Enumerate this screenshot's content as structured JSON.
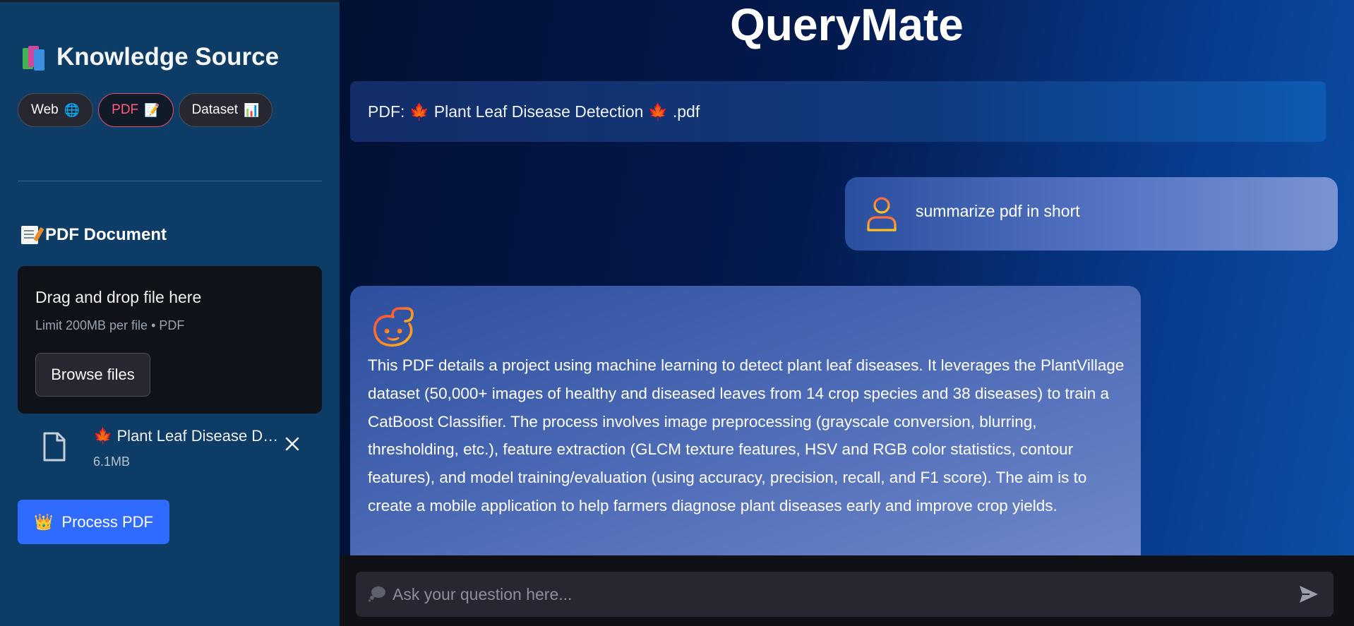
{
  "sidebar": {
    "title": "Knowledge Source",
    "source_tabs": [
      {
        "label": "Web",
        "emoji": "🌐"
      },
      {
        "label": "PDF",
        "emoji": "📝"
      },
      {
        "label": "Dataset",
        "emoji": "📊"
      }
    ],
    "active_tab": "PDF",
    "section_title": "PDF Document",
    "dropzone": {
      "title": "Drag and drop file here",
      "limit": "Limit 200MB per file • PDF",
      "browse_label": "Browse files"
    },
    "uploaded_file": {
      "name": "🍁 Plant Leaf Disease Detection 🍁 .pdf",
      "size": "6.1MB"
    },
    "process_label": "Process PDF",
    "process_emoji": "👑"
  },
  "main": {
    "app_title": "QueryMate",
    "pdf_label": "PDF: 🍁 Plant Leaf Disease Detection 🍁 .pdf",
    "messages": [
      {
        "role": "user",
        "icon": "user-icon",
        "text": "summarize pdf in short"
      },
      {
        "role": "assistant",
        "icon": "bot-icon",
        "text": "This PDF details a project using machine learning to detect plant leaf diseases. It leverages the PlantVillage dataset (50,000+ images of healthy and diseased leaves from 14 crop species and 38 diseases) to train a CatBoost Classifier. The process involves image preprocessing (grayscale conversion, blurring, thresholding, etc.), feature extraction (GLCM texture features, HSV and RGB color statistics, contour features), and model training/evaluation (using accuracy, precision, recall, and F1 score). The aim is to create a mobile application to help farmers diagnose plant diseases early and improve crop yields."
      }
    ]
  },
  "chat_input": {
    "placeholder": "Ask your question here...",
    "value": ""
  },
  "colors": {
    "sidebar_bg": "#0d3c66",
    "accent_button": "#2f6bff",
    "active_pill": "#ff5b7a",
    "icon_orange": "#f08a24"
  }
}
